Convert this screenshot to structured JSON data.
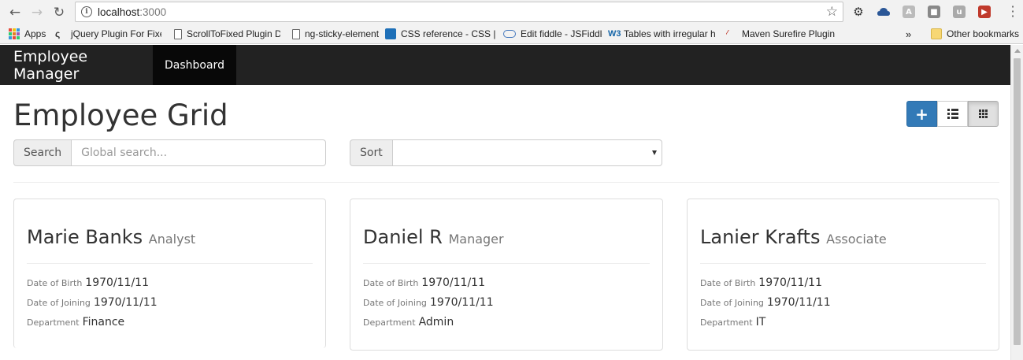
{
  "browser": {
    "url_host": "localhost",
    "url_port": ":3000",
    "bookmarks": [
      {
        "label": "Apps"
      },
      {
        "label": "jQuery Plugin For Fixed"
      },
      {
        "label": "ScrollToFixed Plugin De"
      },
      {
        "label": "ng-sticky-element"
      },
      {
        "label": "CSS reference - CSS | M"
      },
      {
        "label": "Edit fiddle - JSFiddle"
      },
      {
        "label": "Tables with irregular he"
      },
      {
        "label": "Maven Surefire Plugin –"
      }
    ],
    "bookmarks_overflow": "»",
    "other_bookmarks": "Other bookmarks"
  },
  "app": {
    "brand": "Employee Manager",
    "nav": [
      {
        "label": "Dashboard"
      }
    ],
    "title": "Employee Grid",
    "search": {
      "label": "Search",
      "placeholder": "Global search..."
    },
    "sort": {
      "label": "Sort",
      "value": ""
    },
    "toolbar": {
      "add_icon": "plus-icon",
      "list_icon": "list-icon",
      "grid_icon": "grid-icon",
      "active_view": "grid"
    },
    "field_labels": {
      "dob": "Date of Birth",
      "doj": "Date of Joining",
      "dept": "Department"
    },
    "employees": [
      {
        "name": "Marie Banks",
        "role": "Analyst",
        "dob": "1970/11/11",
        "doj": "1970/11/11",
        "dept": "Finance"
      },
      {
        "name": "Daniel R",
        "role": "Manager",
        "dob": "1970/11/11",
        "doj": "1970/11/11",
        "dept": "Admin"
      },
      {
        "name": "Lanier Krafts",
        "role": "Associate",
        "dob": "1970/11/11",
        "doj": "1970/11/11",
        "dept": "IT"
      }
    ]
  },
  "colors": {
    "navbar": "#222222",
    "primary": "#337ab7"
  }
}
